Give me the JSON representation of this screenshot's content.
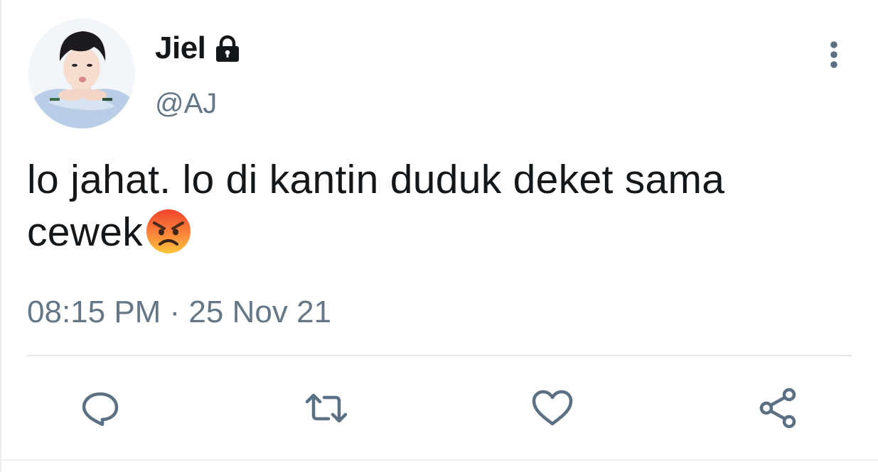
{
  "user": {
    "display_name": "Jiel",
    "handle": "@AJ",
    "protected_icon": "lock-icon",
    "avatar": "user-avatar-photo"
  },
  "tweet": {
    "text": "lo jahat. lo di kantin duduk deket sama cewek",
    "emoji": "angry-face-emoji",
    "timestamp": "08:15 PM · 25 Nov 21"
  },
  "actions": [
    {
      "name": "reply",
      "icon": "speech-bubble-icon"
    },
    {
      "name": "retweet",
      "icon": "retweet-icon"
    },
    {
      "name": "like",
      "icon": "heart-icon"
    },
    {
      "name": "share",
      "icon": "share-icon"
    }
  ],
  "colors": {
    "text_primary": "#14171a",
    "text_secondary": "#657786",
    "icon": "#5b7083",
    "divider": "#e1e8ed"
  }
}
